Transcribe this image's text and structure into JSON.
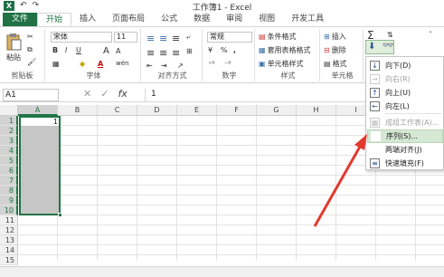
{
  "window": {
    "title": "工作簿1 - Excel",
    "app_icon": "X"
  },
  "quick_access": [
    "↶",
    "↷"
  ],
  "ribbon_tabs": [
    "文件",
    "开始",
    "插入",
    "页面布局",
    "公式",
    "数据",
    "审阅",
    "视图",
    "开发工具"
  ],
  "ribbon": {
    "clipboard": {
      "label": "剪贴板",
      "paste": "粘贴"
    },
    "font": {
      "label": "字体",
      "font_name": "宋体",
      "font_size": "11",
      "bold": "B",
      "italic": "I",
      "underline": "U",
      "grow": "A",
      "shrink": "A",
      "color_a": "A",
      "phonetic": "wén"
    },
    "alignment": {
      "label": "对齐方式"
    },
    "number": {
      "label": "数字",
      "format": "常规",
      "percent": "%",
      "comma": ","
    },
    "styles": {
      "label": "样式",
      "cond_format": "条件格式",
      "table_format": "套用表格格式",
      "cell_style": "单元格样式"
    },
    "cells": {
      "label": "单元格",
      "insert": "插入",
      "delete": "删除",
      "format": "格式"
    }
  },
  "formula_bar": {
    "name_box": "A1",
    "formula": "1",
    "fx": "fx"
  },
  "columns": [
    "A",
    "B",
    "C",
    "D",
    "E",
    "F",
    "G",
    "H",
    "I",
    "J",
    "K"
  ],
  "rows": [
    "1",
    "2",
    "3",
    "4",
    "5",
    "6",
    "7",
    "8",
    "9",
    "10",
    "11",
    "12",
    "13",
    "14",
    "15"
  ],
  "cell_a1": "1",
  "fill_menu": {
    "items": [
      {
        "label": "向下(D)",
        "icon": "↓",
        "enabled": true
      },
      {
        "label": "向右(R)",
        "icon": "→",
        "enabled": false
      },
      {
        "label": "向上(U)",
        "icon": "↑",
        "enabled": true
      },
      {
        "label": "向左(L)",
        "icon": "←",
        "enabled": true
      },
      {
        "label": "成组工作表(A)...",
        "icon": "▦",
        "enabled": false
      },
      {
        "label": "序列(S)...",
        "icon": "",
        "enabled": true,
        "highlighted": true
      },
      {
        "label": "两端对齐(J)",
        "icon": "",
        "enabled": true
      },
      {
        "label": "快速填充(F)",
        "icon": "≡",
        "enabled": true
      }
    ]
  },
  "colors": {
    "excel_green": "#217346",
    "highlight": "#d5e8d4",
    "arrow": "#e03a2f"
  }
}
